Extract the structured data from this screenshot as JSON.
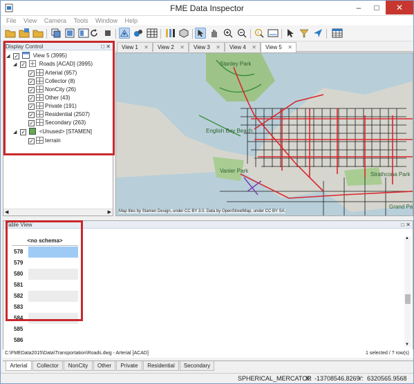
{
  "app": {
    "title": "FME Data Inspector"
  },
  "menu": [
    "File",
    "View",
    "Camera",
    "Tools",
    "Window",
    "Help"
  ],
  "display_control": {
    "title": "Display Control",
    "root": "View 5 (3995)",
    "dataset": "Roads [ACAD] (3995)",
    "layers": [
      "Arterial (957)",
      "Collector (8)",
      "NonCity (26)",
      "Other (43)",
      "Private (191)",
      "Residential (2507)",
      "Secondary (263)"
    ],
    "unused": "<Unused> [STAMEN]",
    "unused_layers": [
      "terrain"
    ]
  },
  "view_tabs": [
    "View 1",
    "View 2",
    "View 3",
    "View 4",
    "View 5"
  ],
  "view_tab_close": "✕",
  "map": {
    "labels": [
      "Stanley Park",
      "English Bay Beach",
      "Vanier Park",
      "Strathcona Park",
      "Grand Park"
    ],
    "credit": "Map tiles by Stamen Design, under CC BY 3.0. Data by OpenStreetMap, under CC BY SA.",
    "road_color": "#d9262c",
    "residential_color": "#1a1a1a",
    "park_color": "#b9d79c",
    "water_color": "#9fc2d9"
  },
  "table_view": {
    "title": "Table View",
    "column_header": "<no schema>",
    "rows": [
      "578",
      "579",
      "580",
      "581",
      "582",
      "583",
      "584",
      "585",
      "586"
    ],
    "path": "C:\\FMEData2015\\Data\\Transportation\\Roads.dwg - Arterial [ACAD]",
    "selection_status": "1 selected / ? row(s)"
  },
  "bottom_tabs": [
    "Arterial",
    "Collector",
    "NonCity",
    "Other",
    "Private",
    "Residential",
    "Secondary"
  ],
  "status": {
    "projection": "SPHERICAL_MERCATOR",
    "x_label": "X:",
    "x_value": "-13708546.8269",
    "y_label": "Y:",
    "y_value": "6320565.9568"
  }
}
